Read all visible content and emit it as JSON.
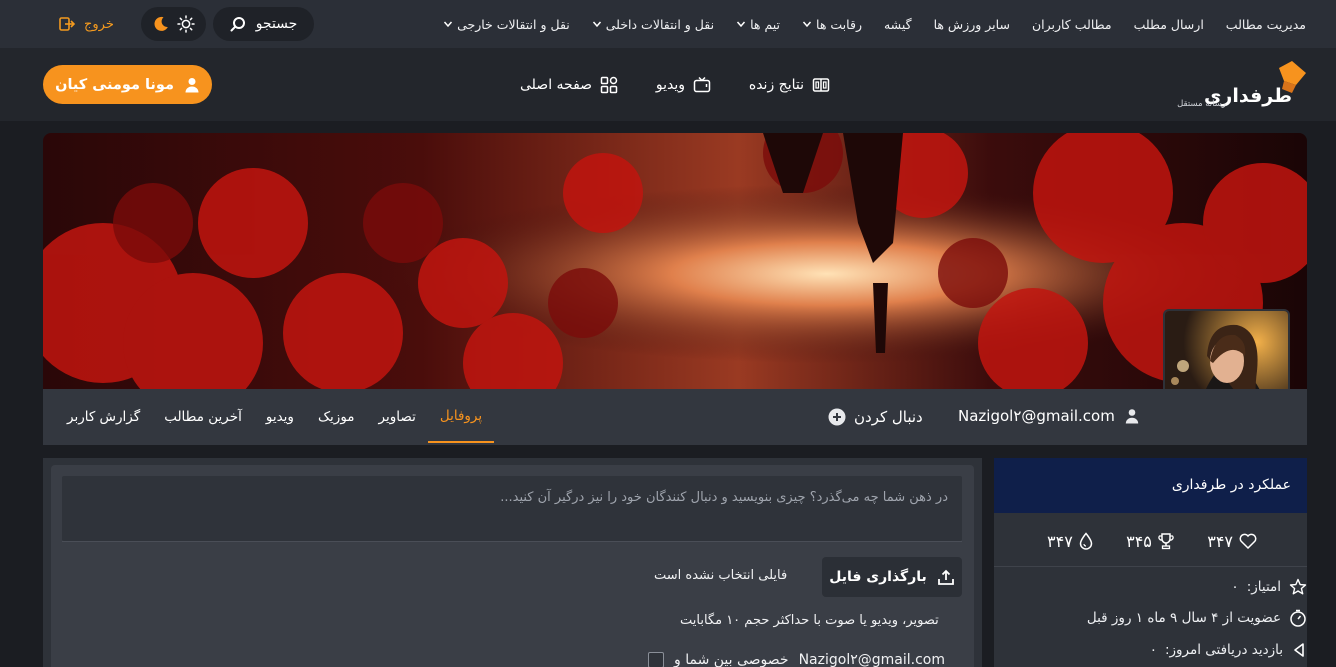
{
  "topbar": {
    "nav_items": [
      {
        "label": "مدیریت مطالب",
        "has_menu": false
      },
      {
        "label": "ارسال مطلب",
        "has_menu": false
      },
      {
        "label": "مطالب کاربران",
        "has_menu": false
      },
      {
        "label": "سایر ورزش ها",
        "has_menu": false
      },
      {
        "label": "گیشه",
        "has_menu": false
      },
      {
        "label": "رقابت ها",
        "has_menu": true
      },
      {
        "label": "تیم ها",
        "has_menu": true
      },
      {
        "label": "نقل و انتقالات داخلی",
        "has_menu": true
      },
      {
        "label": "نقل و انتقالات خارجی",
        "has_menu": true
      }
    ],
    "search_label": "جستجو",
    "logout_label": "خروج"
  },
  "header": {
    "brand": "طرفداری",
    "tagline": "رسانه مستقل",
    "nav": [
      {
        "label": "صفحه اصلی",
        "icon": "grid-icon"
      },
      {
        "label": "ویدیو",
        "icon": "tv-icon"
      },
      {
        "label": "نتایج زنده",
        "icon": "scoreboard-icon"
      }
    ],
    "user_button_label": "مونا مومنی کیان"
  },
  "profile": {
    "email": "Nazigol۲@gmail.com",
    "follow_label": "دنبال کردن",
    "tabs": [
      "پروفایل",
      "تصاویر",
      "موزیک",
      "ویدیو",
      "آخرین مطالب",
      "گزارش کاربر"
    ],
    "active_tab": "پروفایل"
  },
  "composer": {
    "placeholder": "در ذهن شما چه می‌گذرد؟ چیزی بنویسید و دنبال کنندگان خود را نیز درگیر آن کنید...",
    "upload_button_label": "بارگذاری فایل",
    "no_file_text": "فایلی انتخاب نشده است",
    "upload_hint": "تصویر، ویدیو یا صوت با حداکثر حجم ۱۰ مگابایت",
    "private_label": "خصوصی بین شما و",
    "private_email": "Nazigol۲@gmail.com"
  },
  "stats": {
    "title": "عملکرد در طرفداری",
    "counters": [
      {
        "icon": "drop-icon",
        "value": "۳۴۷"
      },
      {
        "icon": "trophy-icon",
        "value": "۳۴۵"
      },
      {
        "icon": "heart-icon",
        "value": "۳۴۷"
      }
    ],
    "score_label": "امتیاز:",
    "score_value": "۰",
    "membership": "عضویت از ۴ سال ۹ ماه ۱ روز قبل",
    "views_label": "بازدید دریافتی امروز:",
    "views_value": "۰"
  },
  "colors": {
    "accent": "#f7931e",
    "topbar": "#2b2f37",
    "header": "#23262c",
    "stats_header": "#0f1f4a"
  }
}
